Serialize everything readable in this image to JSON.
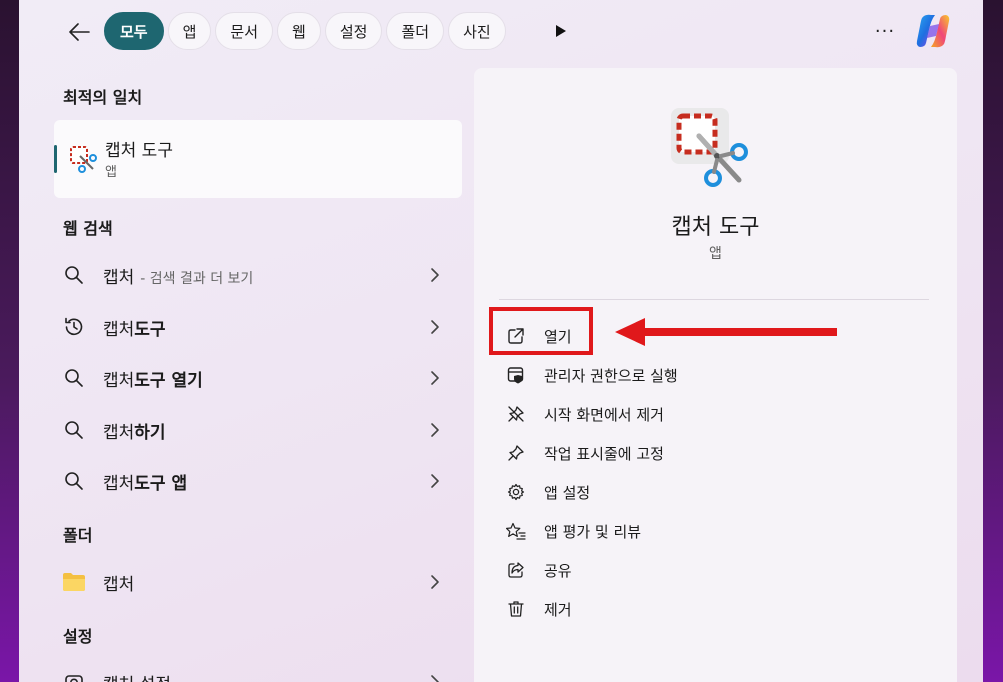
{
  "filters": {
    "back_icon": "arrow-left-icon",
    "tabs": [
      {
        "label": "모두",
        "active": true
      },
      {
        "label": "앱",
        "active": false
      },
      {
        "label": "문서",
        "active": false
      },
      {
        "label": "웹",
        "active": false
      },
      {
        "label": "설정",
        "active": false
      },
      {
        "label": "폴더",
        "active": false
      },
      {
        "label": "사진",
        "active": false
      }
    ],
    "more_icon": "play-arrow-icon",
    "options_label": "···"
  },
  "best_match": {
    "heading": "최적의 일치",
    "name": "캡처 도구",
    "type": "앱"
  },
  "web_search": {
    "heading": "웹 검색",
    "items": [
      {
        "prefix": "캡처",
        "bold": "",
        "suffix": "- 검색 결과 더 보기",
        "icon": "search-icon"
      },
      {
        "prefix": "캡처",
        "bold": "도구",
        "suffix": "",
        "icon": "history-icon"
      },
      {
        "prefix": "캡처",
        "bold": "도구 열기",
        "suffix": "",
        "icon": "search-icon"
      },
      {
        "prefix": "캡처",
        "bold": "하기",
        "suffix": "",
        "icon": "search-icon"
      },
      {
        "prefix": "캡처",
        "bold": "도구 앱",
        "suffix": "",
        "icon": "search-icon"
      }
    ]
  },
  "folders": {
    "heading": "폴더",
    "items": [
      {
        "label": "캡처",
        "icon": "folder-icon"
      }
    ]
  },
  "settings": {
    "heading": "설정",
    "items": [
      {
        "label": "캡처 설정",
        "icon": "camera-icon"
      }
    ]
  },
  "detail": {
    "name": "캡처 도구",
    "type": "앱",
    "actions": [
      {
        "label": "열기",
        "icon": "open-external-icon"
      },
      {
        "label": "관리자 권한으로 실행",
        "icon": "shield-admin-icon"
      },
      {
        "label": "시작 화면에서 제거",
        "icon": "unpin-icon"
      },
      {
        "label": "작업 표시줄에 고정",
        "icon": "pin-icon"
      },
      {
        "label": "앱 설정",
        "icon": "gear-icon"
      },
      {
        "label": "앱 평가 및 리뷰",
        "icon": "star-review-icon"
      },
      {
        "label": "공유",
        "icon": "share-icon"
      },
      {
        "label": "제거",
        "icon": "trash-icon"
      }
    ]
  },
  "colors": {
    "accent": "#1e6670",
    "highlight": "#e0181b"
  }
}
